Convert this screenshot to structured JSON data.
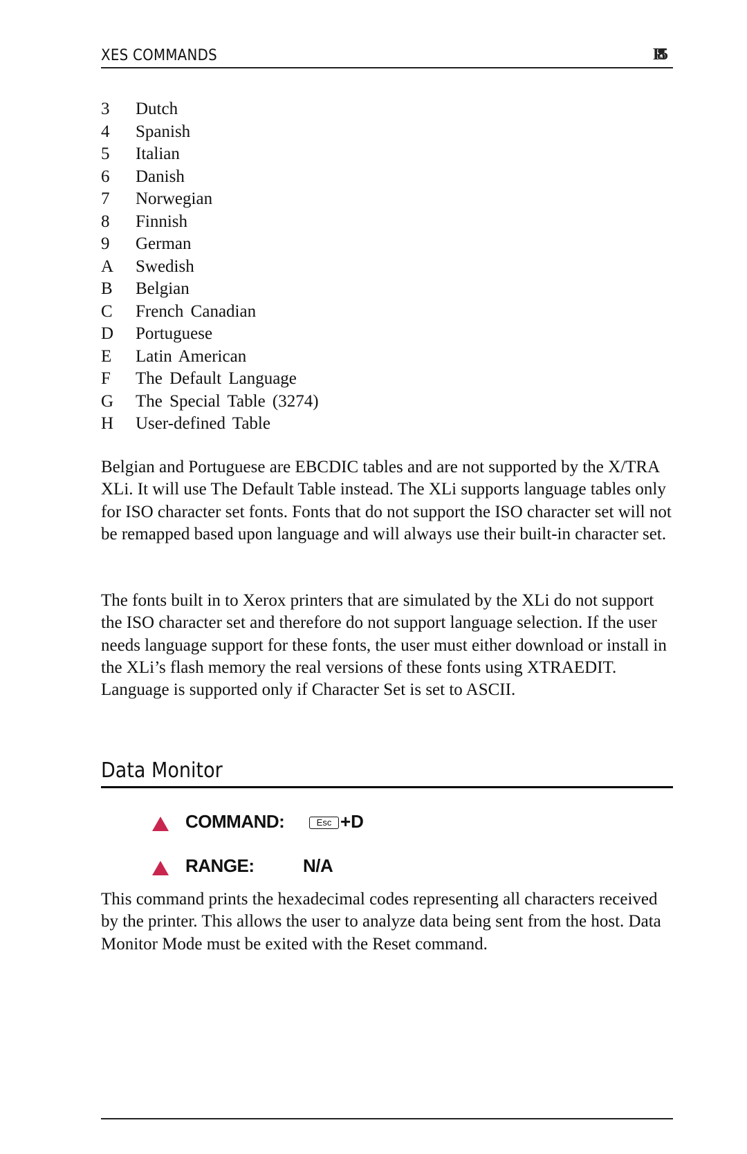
{
  "header": {
    "running_head": "XES COMMANDS",
    "page_number_overlay": [
      "P",
      "8",
      "5"
    ]
  },
  "language_list": [
    {
      "code": "3",
      "name": "Dutch"
    },
    {
      "code": "4",
      "name": "Spanish"
    },
    {
      "code": "5",
      "name": "Italian"
    },
    {
      "code": "6",
      "name": "Danish"
    },
    {
      "code": "7",
      "name": "Norwegian"
    },
    {
      "code": "8",
      "name": "Finnish"
    },
    {
      "code": "9",
      "name": "German"
    },
    {
      "code": "A",
      "name": "Swedish"
    },
    {
      "code": "B",
      "name": "Belgian"
    },
    {
      "code": "C",
      "name": "French Canadian"
    },
    {
      "code": "D",
      "name": "Portuguese"
    },
    {
      "code": "E",
      "name": "Latin American"
    },
    {
      "code": "F",
      "name": "The Default Language"
    },
    {
      "code": "G",
      "name": "The Special Table (3274)"
    },
    {
      "code": "H",
      "name": "User-defined Table"
    }
  ],
  "paragraphs": {
    "p1": "Belgian and Portuguese are EBCDIC tables and are not supported by the X/TRA XLi. It will use The Default Table instead. The XLi supports language tables only for ISO character set fonts. Fonts that do not support the ISO character set will not be remapped based upon language and will always use their built-in character set.",
    "p2": "The fonts built in to Xerox printers that are simulated by the XLi do not support the ISO character set and therefore do not support language selection. If the user needs language support for these fonts, the user must either download or install in the XLi’s flash memory the real versions of these fonts using XTRAEDIT. Language is supported only if Character Set is set to ASCII.",
    "p3": "This command prints the hexadecimal codes representing all characters received by the printer. This allows the user to analyze data being sent from the host. Data Monitor Mode must be exited with the Reset command."
  },
  "section": {
    "title": "Data Monitor",
    "command_label": "COMMAND:",
    "command_key": "Esc",
    "command_suffix": "+D",
    "range_label": "RANGE:",
    "range_value": "N/A",
    "bullet_icon": "triangle-bullet",
    "accent_color": "#c8254f"
  }
}
